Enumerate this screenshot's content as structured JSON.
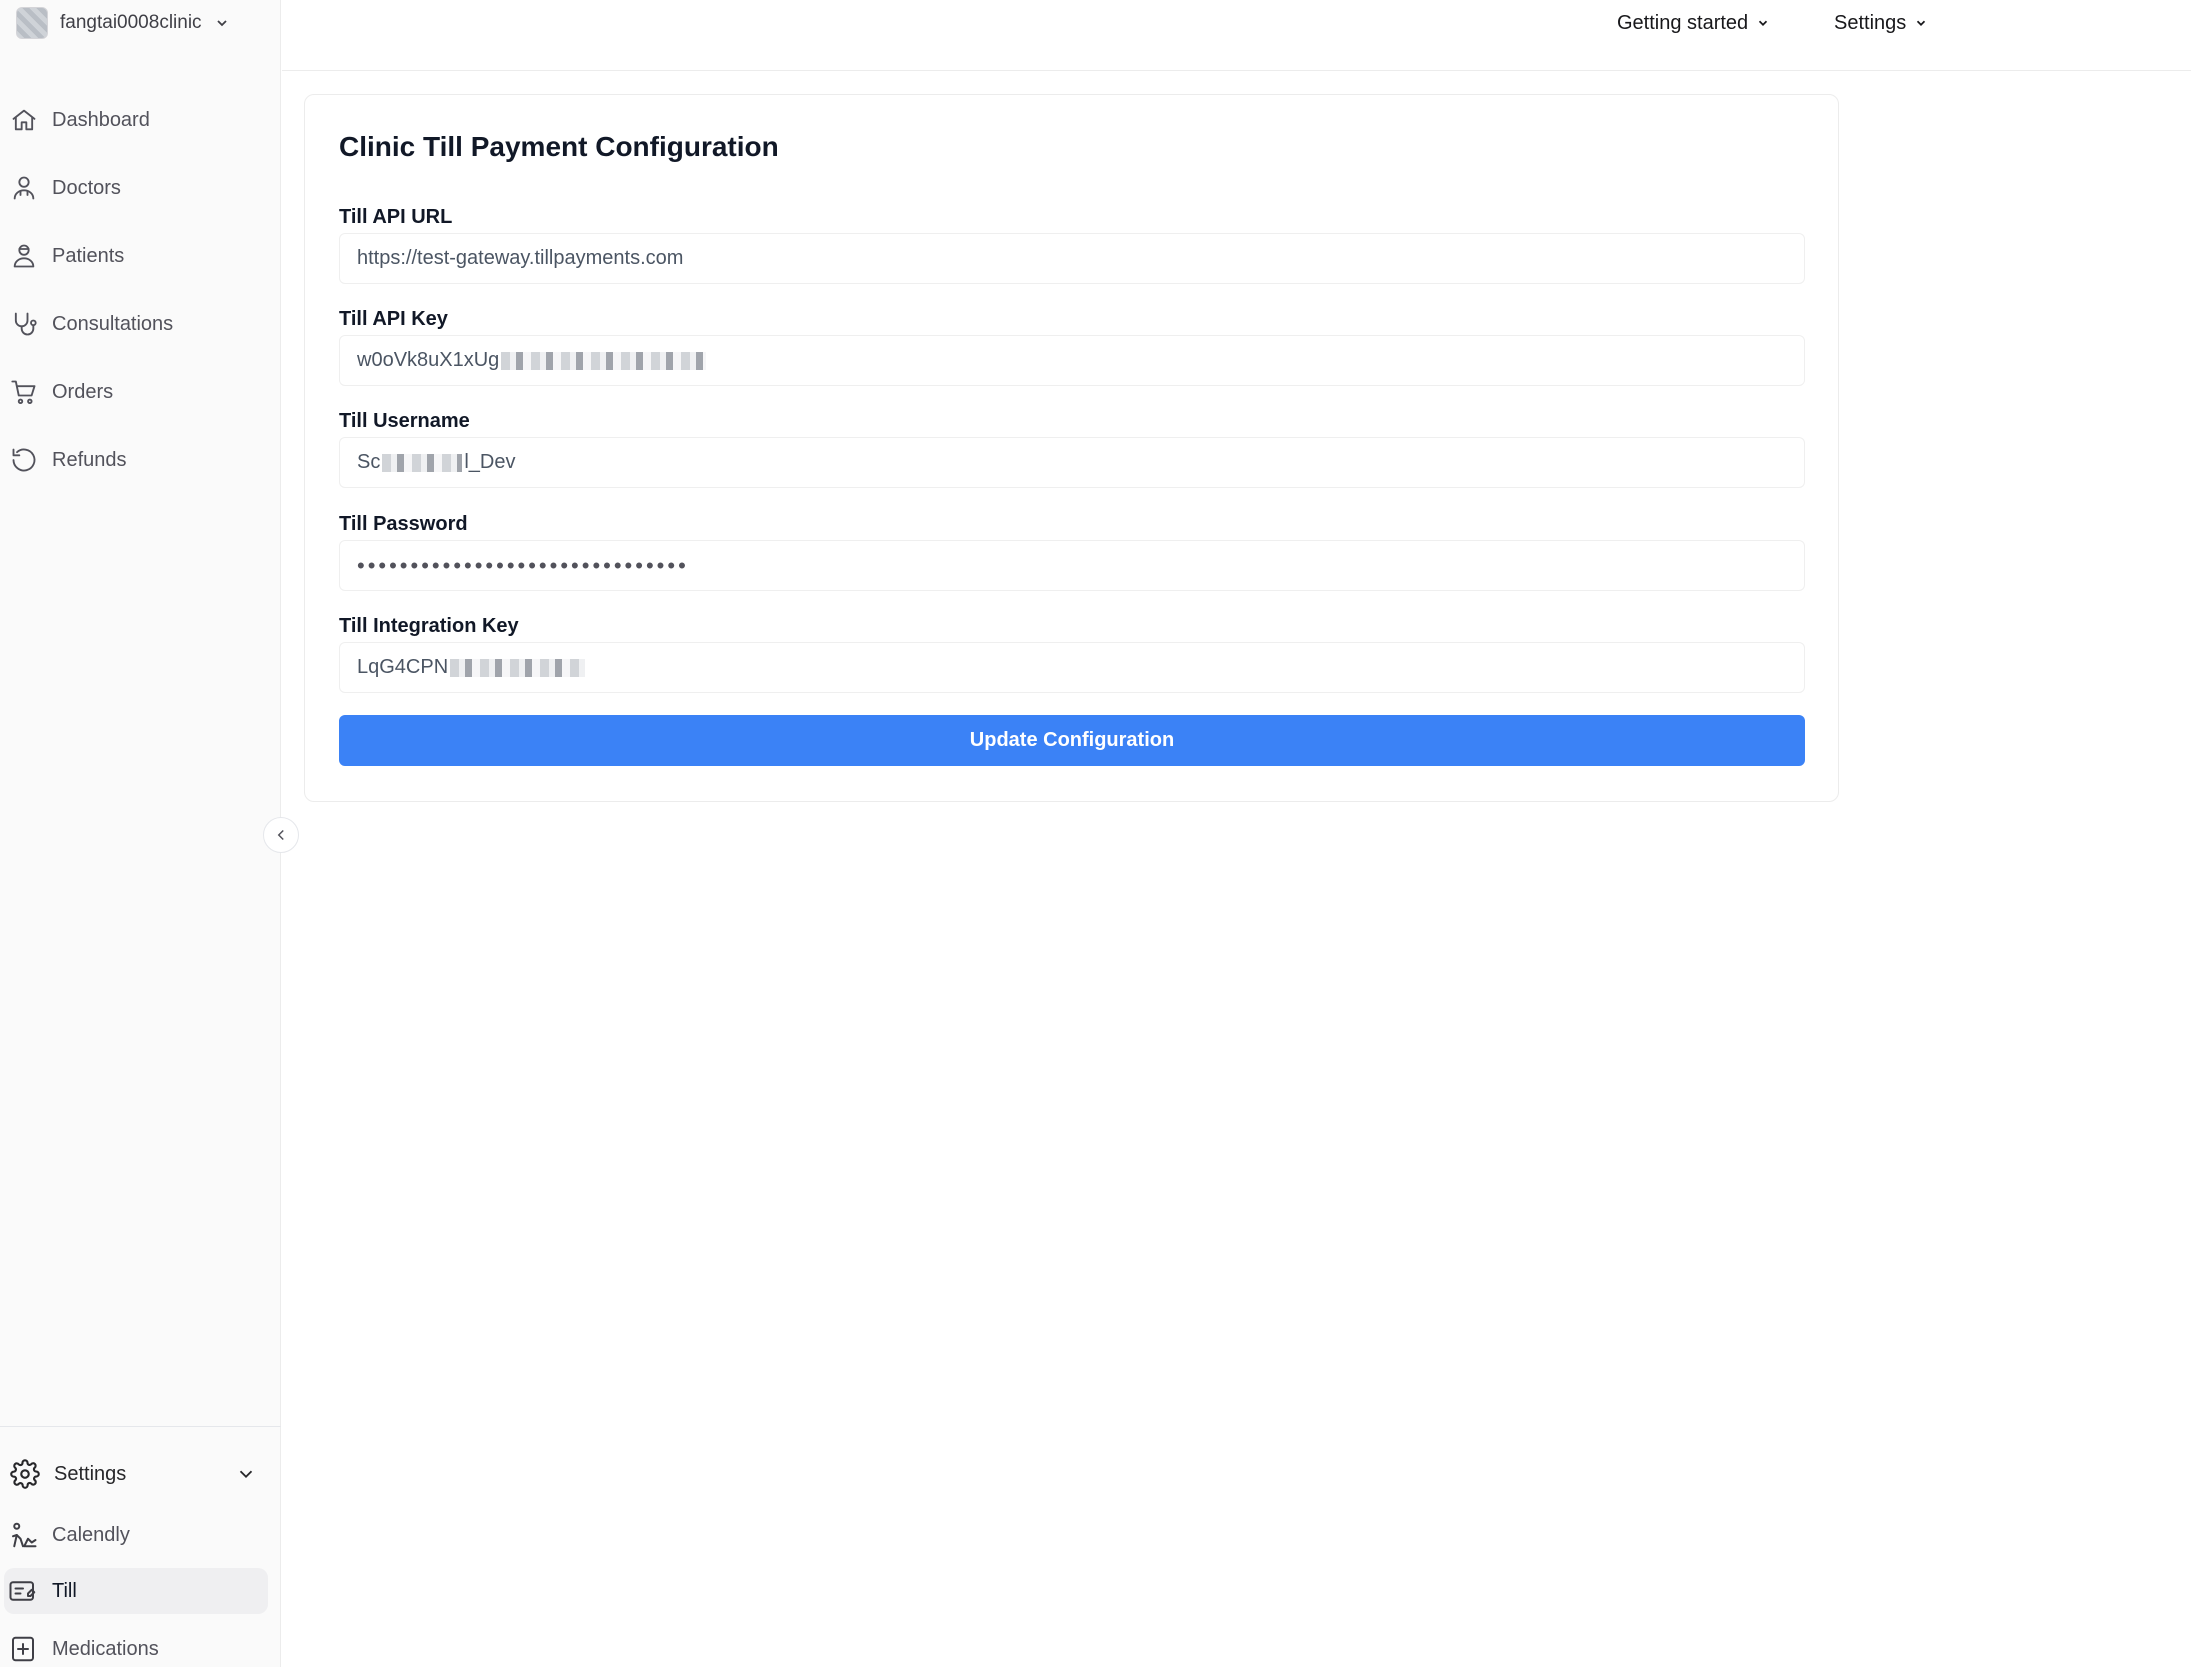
{
  "clinic": {
    "name": "fangtai0008clinic"
  },
  "sidebar": {
    "items": [
      {
        "label": "Dashboard",
        "icon": "home-icon"
      },
      {
        "label": "Doctors",
        "icon": "doctor-icon"
      },
      {
        "label": "Patients",
        "icon": "patient-icon"
      },
      {
        "label": "Consultations",
        "icon": "stethoscope-icon"
      },
      {
        "label": "Orders",
        "icon": "cart-icon"
      },
      {
        "label": "Refunds",
        "icon": "undo-icon"
      }
    ],
    "settings": {
      "label": "Settings",
      "items": [
        {
          "label": "Calendly",
          "icon": "calendar-person-icon"
        },
        {
          "label": "Till",
          "icon": "till-icon",
          "active": true
        },
        {
          "label": "Medications",
          "icon": "medical-box-icon"
        }
      ]
    }
  },
  "topbar": {
    "getting_started": "Getting started",
    "settings": "Settings"
  },
  "form": {
    "title": "Clinic Till Payment Configuration",
    "api_url_label": "Till API URL",
    "api_url_value": "https://test-gateway.tillpayments.com",
    "api_key_label": "Till API Key",
    "api_key_value": "w0oVk8uX1xUg",
    "username_label": "Till Username",
    "username_prefix": "Sc",
    "username_suffix": "l_Dev",
    "password_label": "Till Password",
    "password_value": "•••••••••••••••••••••••••••••••",
    "integration_key_label": "Till Integration Key",
    "integration_key_value": "LqG4CPN",
    "submit_label": "Update Configuration"
  },
  "colors": {
    "accent": "#3b82f6",
    "sidebar_bg": "#fafafa",
    "active_bg": "#efeff1"
  }
}
